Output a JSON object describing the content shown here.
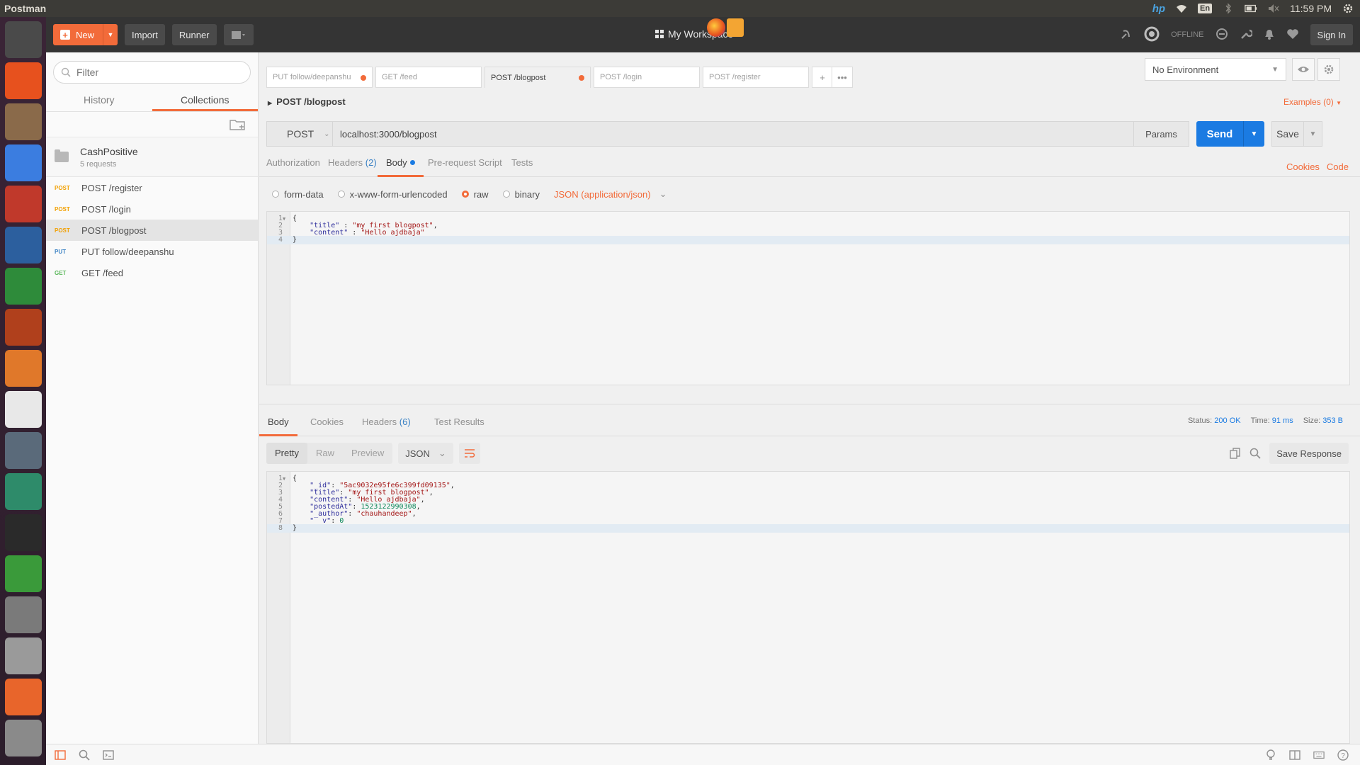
{
  "system": {
    "app_title": "Postman",
    "lang": "En",
    "time": "11:59 PM",
    "brand": "hp"
  },
  "launcher": [
    {
      "name": "ubuntu-icon",
      "color": "#4a4a4a"
    },
    {
      "name": "firefox-icon",
      "color": "#e7511e"
    },
    {
      "name": "files-icon",
      "color": "#8a6a4a"
    },
    {
      "name": "chrome-icon",
      "color": "#3b7de0"
    },
    {
      "name": "popcorn-icon",
      "color": "#c0392b"
    },
    {
      "name": "writer-icon",
      "color": "#2c5f9e"
    },
    {
      "name": "calc-icon",
      "color": "#2e8b3a"
    },
    {
      "name": "impress-icon",
      "color": "#b0401c"
    },
    {
      "name": "software-icon",
      "color": "#e0782a"
    },
    {
      "name": "amazon-icon",
      "color": "#e8e8e8"
    },
    {
      "name": "settings-icon",
      "color": "#5a6a7a"
    },
    {
      "name": "atom-icon",
      "color": "#2e8b6a"
    },
    {
      "name": "terminal-icon",
      "color": "#2a2a2a"
    },
    {
      "name": "robot-icon",
      "color": "#3a9a3a"
    },
    {
      "name": "editor-icon",
      "color": "#7a7a7a"
    },
    {
      "name": "camera-icon",
      "color": "#9a9a9a"
    },
    {
      "name": "postman-icon",
      "color": "#e8652b"
    },
    {
      "name": "drive-icon",
      "color": "#8a8a8a"
    }
  ],
  "header": {
    "new_label": "New",
    "import_label": "Import",
    "runner_label": "Runner",
    "workspace": "My Workspace",
    "offline": "OFFLINE",
    "signin_label": "Sign In"
  },
  "sidebar": {
    "filter_placeholder": "Filter",
    "tabs": [
      "History",
      "Collections"
    ],
    "collection": {
      "name": "CashPositive",
      "count": "5 requests"
    },
    "requests": [
      {
        "method": "POST",
        "name": "POST /register"
      },
      {
        "method": "POST",
        "name": "POST /login"
      },
      {
        "method": "POST",
        "name": "POST /blogpost"
      },
      {
        "method": "PUT",
        "name": "PUT follow/deepanshu"
      },
      {
        "method": "GET",
        "name": "GET /feed"
      }
    ]
  },
  "tabs": [
    {
      "label": "PUT follow/deepanshu"
    },
    {
      "label": "GET /feed"
    },
    {
      "label": "POST /blogpost"
    },
    {
      "label": "POST /login"
    },
    {
      "label": "POST /register"
    }
  ],
  "environment": "No Environment",
  "request": {
    "title": "POST /blogpost",
    "examples": "Examples (0)",
    "method": "POST",
    "url": "localhost:3000/blogpost",
    "params_label": "Params",
    "send_label": "Send",
    "save_label": "Save",
    "tabs": {
      "authorization": "Authorization",
      "headers": "Headers",
      "headers_count": "(2)",
      "body": "Body",
      "prerequest": "Pre-request Script",
      "tests": "Tests"
    },
    "cookies": "Cookies",
    "code": "Code",
    "body_options": {
      "form_data": "form-data",
      "urlencoded": "x-www-form-urlencoded",
      "raw": "raw",
      "binary": "binary",
      "content_type": "JSON (application/json)"
    },
    "body_lines": [
      "{",
      "    \"title\" : \"my first blogpost\",",
      "    \"content\" : \"Hello ajdbaja\"",
      "}"
    ]
  },
  "response": {
    "tabs": {
      "body": "Body",
      "cookies": "Cookies",
      "headers": "Headers",
      "headers_count": "(6)",
      "tests": "Test Results"
    },
    "status_label": "Status:",
    "status": "200 OK",
    "time_label": "Time:",
    "time": "91 ms",
    "size_label": "Size:",
    "size": "353 B",
    "views": [
      "Pretty",
      "Raw",
      "Preview"
    ],
    "format": "JSON",
    "save_response": "Save Response",
    "body_lines": [
      "{",
      "    \"_id\": \"5ac9032e95fe6c399fd09135\",",
      "    \"title\": \"my first blogpost\",",
      "    \"content\": \"Hello ajdbaja\",",
      "    \"postedAt\": 1523122990308,",
      "    \"_author\": \"chauhandeep\",",
      "    \"__v\": 0",
      "}"
    ]
  }
}
